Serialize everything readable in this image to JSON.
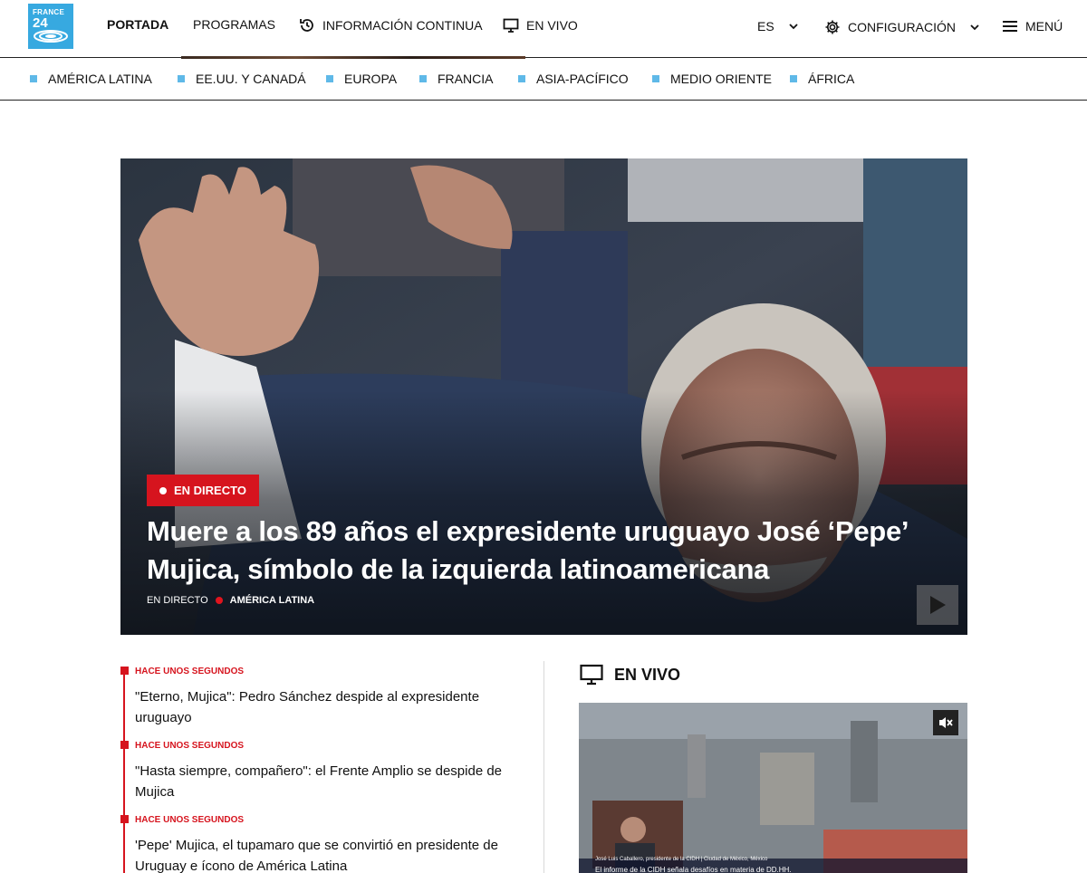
{
  "header": {
    "logo": {
      "line1": "FRANCE",
      "line2": "24"
    },
    "nav": {
      "portada": "PORTADA",
      "programas": "PROGRAMAS",
      "info_continua": "INFORMACIÓN CONTINUA",
      "en_vivo": "EN VIVO",
      "language": "ES",
      "config": "CONFIGURACIÓN",
      "menu": "MENÚ"
    },
    "icons": {
      "info_continua": "history-clock-icon",
      "en_vivo": "tv-icon",
      "config": "gear-icon",
      "menu": "hamburger-menu-icon"
    }
  },
  "regions": [
    "AMÉRICA LATINA",
    "EE.UU. Y CANADÁ",
    "EUROPA",
    "FRANCIA",
    "ASIA-PACÍFICO",
    "MEDIO ORIENTE",
    "ÁFRICA"
  ],
  "hero": {
    "badge": "EN DIRECTO",
    "title": "Muere a los 89 años el expresidente uruguayo José ‘Pepe’ Mujica, símbolo de la izquierda latinoamericana",
    "meta_type": "EN DIRECTO",
    "meta_category": "AMÉRICA LATINA"
  },
  "feed": [
    {
      "time": "HACE UNOS SEGUNDOS",
      "headline": "\"Eterno, Mujica\": Pedro Sánchez despide al expresidente uruguayo"
    },
    {
      "time": "HACE UNOS SEGUNDOS",
      "headline": "\"Hasta siempre, compañero\": el Frente Amplio se despide de Mujica"
    },
    {
      "time": "HACE UNOS SEGUNDOS",
      "headline": "'Pepe' Mujica, el tupamaro que se convirtió en presidente de Uruguay e ícono de América Latina"
    }
  ],
  "live": {
    "heading": "EN VIVO",
    "video_caption": "José Luis Caballero, presidente de la CIDH | Ciudad de México, México",
    "video_ticker": "El informe de la CIDH señala desafíos en materia de DD.HH."
  },
  "colors": {
    "brand_blue": "#37a9e0",
    "region_square": "#5fb9e8",
    "live_red": "#d6141e"
  }
}
